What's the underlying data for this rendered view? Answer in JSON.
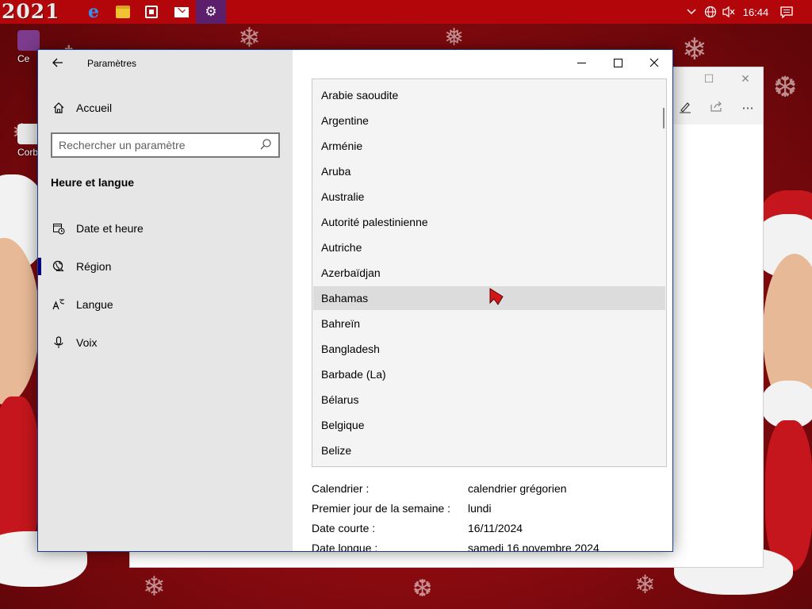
{
  "taskbar": {
    "year_text": "2021",
    "apps": [
      {
        "icon": "edge-icon",
        "color": "#1f6fd1"
      },
      {
        "icon": "file-explorer-icon",
        "color": "#f1c232"
      },
      {
        "icon": "store-icon",
        "color": "#ffffff"
      },
      {
        "icon": "mail-icon",
        "color": "#ffffff"
      },
      {
        "icon": "settings-icon",
        "color": "#ffffff"
      }
    ],
    "clock": "16:44"
  },
  "desktop": {
    "icons": [
      {
        "label": "Ce"
      },
      {
        "label": "Corb"
      }
    ]
  },
  "window": {
    "app_title": "Paramètres",
    "home_label": "Accueil",
    "search_placeholder": "Rechercher un paramètre",
    "section_title": "Heure et langue",
    "nav_items": [
      {
        "label": "Date et heure",
        "icon": "calendar-clock-icon",
        "selected": false
      },
      {
        "label": "Région",
        "icon": "globe-icon",
        "selected": true
      },
      {
        "label": "Langue",
        "icon": "language-icon",
        "selected": false
      },
      {
        "label": "Voix",
        "icon": "microphone-icon",
        "selected": false
      }
    ]
  },
  "dropdown": {
    "options": [
      "Arabie saoudite",
      "Argentine",
      "Arménie",
      "Aruba",
      "Australie",
      "Autorité palestinienne",
      "Autriche",
      "Azerbaïdjan",
      "Bahamas",
      "Bahreïn",
      "Bangladesh",
      "Barbade (La)",
      "Bélarus",
      "Belgique",
      "Belize"
    ],
    "highlighted": "Bahamas"
  },
  "format_info": [
    {
      "label": "Calendrier :",
      "value": "calendrier grégorien"
    },
    {
      "label": "Premier jour de la semaine :",
      "value": "lundi"
    },
    {
      "label": "Date courte :",
      "value": "16/11/2024"
    },
    {
      "label": "Date longue :",
      "value": "samedi 16 novembre 2024"
    }
  ],
  "colors": {
    "taskbar": "#b3060b",
    "accent": "#000080",
    "sidebar": "#e6e6e6",
    "active_app": "#5b1f6b"
  }
}
